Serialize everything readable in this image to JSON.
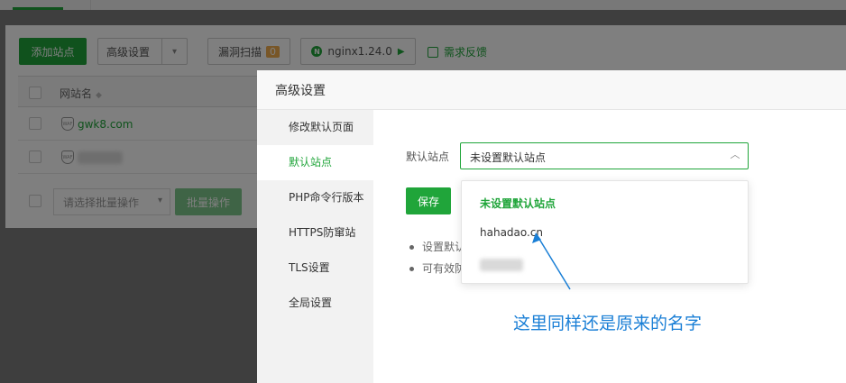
{
  "toolbar": {
    "add_site": "添加站点",
    "advanced": "高级设置",
    "vuln_scan": "漏洞扫描",
    "vuln_count": "0",
    "nginx": "nginx1.24.0",
    "nginx_icon": "N",
    "feedback": "需求反馈"
  },
  "table": {
    "col_name": "网站名",
    "rows": [
      {
        "name": "gwk8.com"
      },
      {
        "name": ""
      }
    ],
    "shield_text": "WAF",
    "batch_placeholder": "请选择批量操作",
    "batch_button": "批量操作"
  },
  "modal": {
    "title": "高级设置",
    "menu": [
      "修改默认页面",
      "默认站点",
      "PHP命令行版本",
      "HTTPS防窜站",
      "TLS设置",
      "全局设置"
    ],
    "active_index": 1,
    "field_label": "默认站点",
    "select_value": "未设置默认站点",
    "save": "保存",
    "tips": [
      "设置默认",
      "可有效防"
    ]
  },
  "dropdown": {
    "options": [
      "未设置默认站点",
      "hahadao.cn",
      ""
    ]
  },
  "annotation": "这里同样还是原来的名字",
  "colors": {
    "accent": "#20a53a",
    "annotation": "#1a7fd6"
  }
}
